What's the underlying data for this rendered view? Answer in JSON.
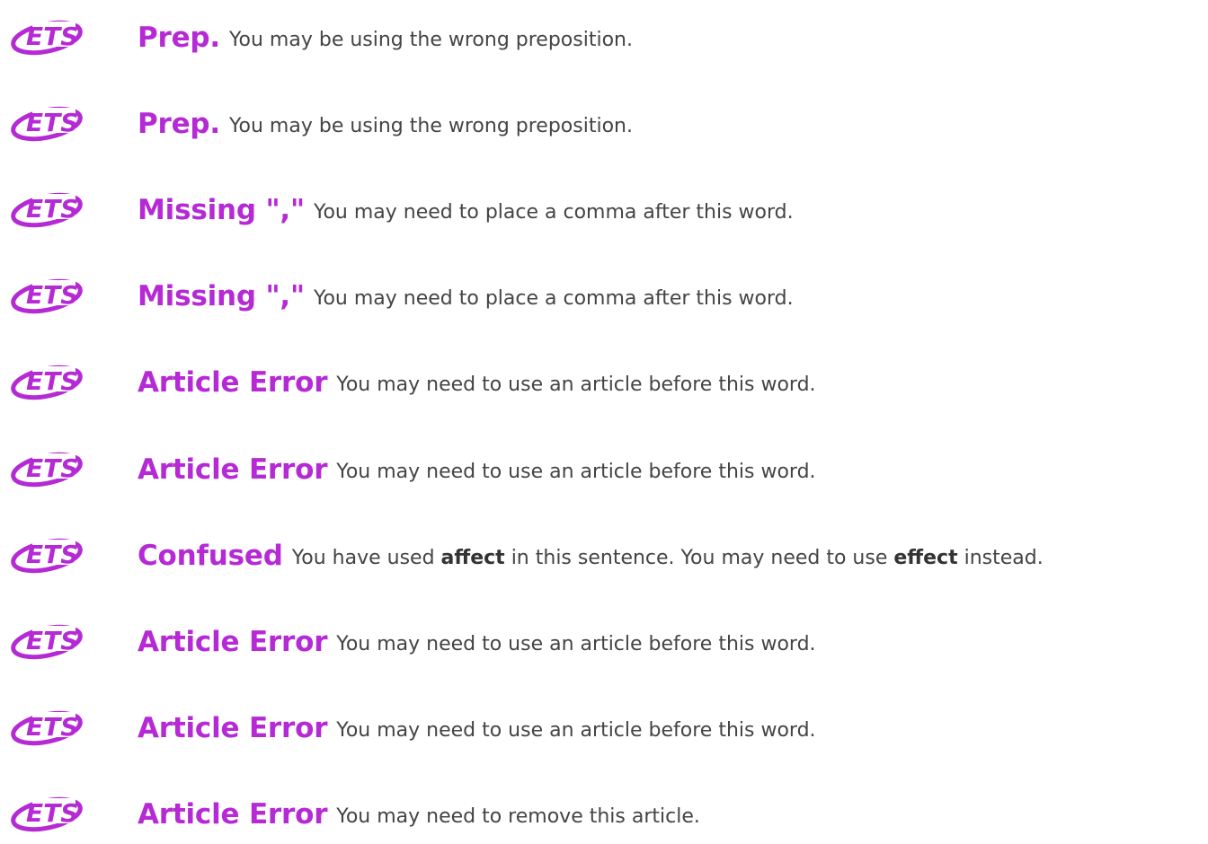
{
  "brand": {
    "logo_text": "ETS",
    "logo_icon": "ets-logo-icon",
    "accent_color": "#b52ad4",
    "text_color": "#444444"
  },
  "feedback": [
    {
      "category": "Prep.",
      "message": "You may be using the wrong preposition."
    },
    {
      "category": "Prep.",
      "message": "You may be using the wrong preposition."
    },
    {
      "category": "Missing \",\"",
      "message": "You may need to place a comma after this word."
    },
    {
      "category": "Missing \",\"",
      "message": "You may need to place a comma after this word."
    },
    {
      "category": "Article Error",
      "message": "You may need to use an article before this word."
    },
    {
      "category": "Article Error",
      "message": "You may need to use an article before this word."
    },
    {
      "category": "Confused",
      "message_parts": [
        "You have used ",
        "affect",
        " in this sentence. You may need to use ",
        "effect",
        " instead."
      ]
    },
    {
      "category": "Article Error",
      "message": "You may need to use an article before this word."
    },
    {
      "category": "Article Error",
      "message": "You may need to use an article before this word."
    },
    {
      "category": "Article Error",
      "message": "You may need to remove this article."
    }
  ]
}
